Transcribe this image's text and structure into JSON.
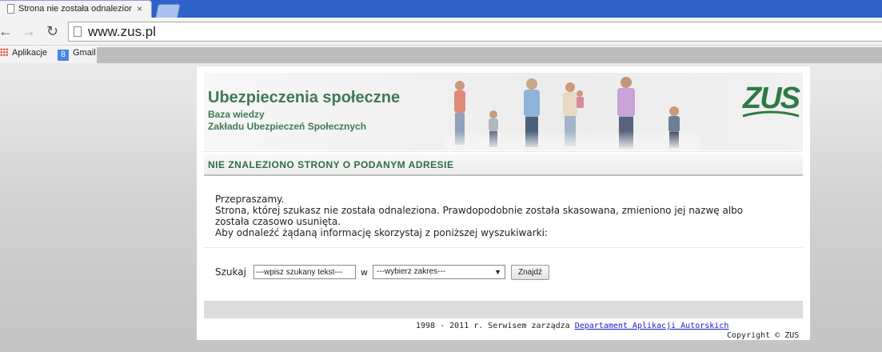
{
  "browser": {
    "tab_title": "Strona nie została odnaleziona",
    "tab_close": "×",
    "url": "www.zus.pl",
    "bookmarks": [
      {
        "label": "Aplikacje"
      },
      {
        "label": "Gmail"
      }
    ]
  },
  "banner": {
    "title": "Ubezpieczenia społeczne",
    "subtitle_line1": "Baza wiedzy",
    "subtitle_line2": "Zakładu Ubezpieczeń Społecznych",
    "logo_text": "ZUS",
    "brand_color": "#3f7a52"
  },
  "heading": "NIE ZNALEZIONO STRONY O PODANYM ADRESIE",
  "message": {
    "line1": "Przepraszamy.",
    "line2": "Strona, której szukasz nie została odnaleziona. Prawdopodobnie została skasowana, zmieniono jej nazwę albo",
    "line3": "została czasowo usunięta.",
    "line4": "Aby odnaleźć żądaną informację skorzystaj z poniższej wyszukiwarki:"
  },
  "search": {
    "label": "Szukaj",
    "input_value": "---wpisz szukany tekst---",
    "in_label": "w",
    "scope_value": "---wybierz zakres---",
    "button_label": "Znajdź"
  },
  "footer": {
    "text": "1998 - 2011 r. Serwisem zarządza",
    "link_text": "Departament Aplikacji Autorskich",
    "copyright": "Copyright © ZUS"
  }
}
